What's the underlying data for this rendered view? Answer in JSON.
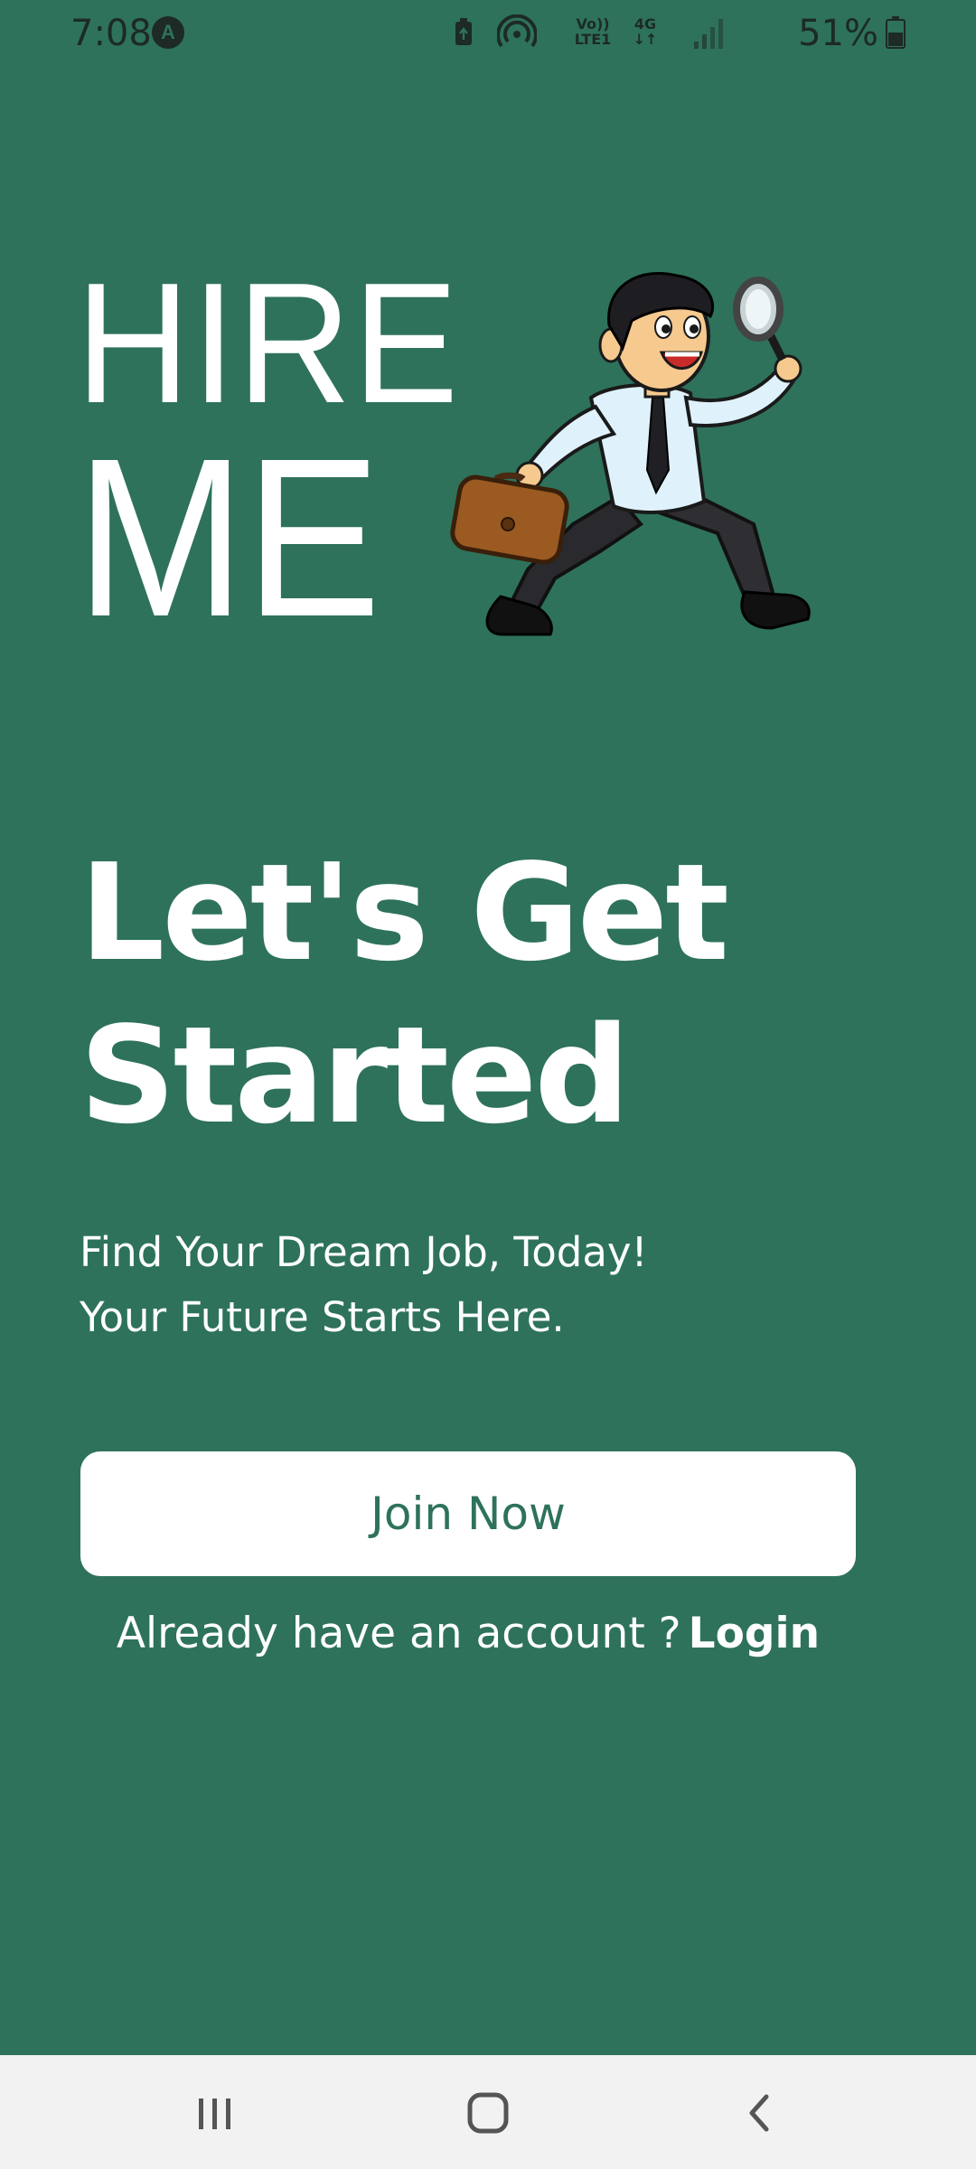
{
  "status_bar": {
    "time": "7:08",
    "app_icon": "A",
    "volte_line1": "Vo))",
    "volte_line2": "LTE1",
    "network": "4G",
    "network_arrows": "↓↑",
    "battery_percent": "51%",
    "icons": [
      "app-notification-icon",
      "battery-saver-icon",
      "hotspot-icon",
      "volte-icon",
      "signal-icon",
      "battery-icon"
    ]
  },
  "logo": {
    "line1": "HIRE",
    "line2": "ME",
    "mascot": "running-businessman-with-magnifier-and-briefcase"
  },
  "headline": {
    "line1": "Let's Get",
    "line2": "Started"
  },
  "subtitle": {
    "line1": "Find Your Dream Job, Today!",
    "line2": "Your Future Starts Here."
  },
  "cta": {
    "join_label": "Join Now",
    "login_prompt": "Already have an account ?",
    "login_label": "Login"
  },
  "nav_bar": {
    "buttons": [
      "recents-icon",
      "home-icon",
      "back-icon"
    ]
  },
  "colors": {
    "background": "#2e725b",
    "button_bg": "#ffffff",
    "button_text": "#2e725b",
    "text": "#ffffff",
    "status_text": "#1d2a25",
    "nav_bg": "#f2f2f2"
  }
}
